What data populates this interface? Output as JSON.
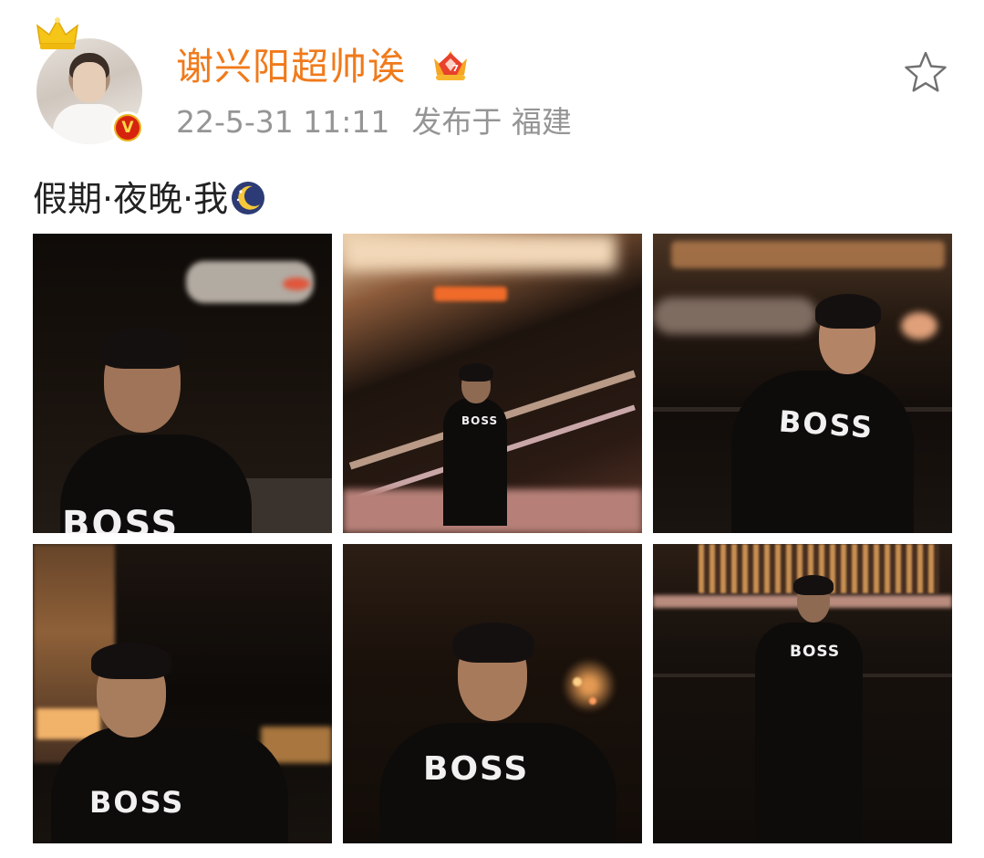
{
  "post": {
    "author": "谢兴阳超帅诶",
    "timestamp": "22-5-31 11:11",
    "location": "发布于 福建",
    "text": "假期·夜晚·我",
    "icons": {
      "crown": "crown-icon",
      "verified": "verified-badge-icon",
      "vip": "vip-crown-icon",
      "favorite": "star-icon",
      "emoji": "moon-emoji"
    },
    "verified_letter": "V",
    "colors": {
      "author": "#f07a1b",
      "meta": "#959595",
      "text": "#222222",
      "verified_bg": "#d6230f",
      "crown": "#f5c518"
    }
  },
  "photos": [
    {
      "logo": "BOSS",
      "alt": "photo-1"
    },
    {
      "logo": "BOSS",
      "alt": "photo-2"
    },
    {
      "logo": "BOSS",
      "alt": "photo-3"
    },
    {
      "logo": "BOSS",
      "alt": "photo-4"
    },
    {
      "logo": "BOSS",
      "alt": "photo-5"
    },
    {
      "logo": "BOSS",
      "alt": "photo-6"
    }
  ]
}
